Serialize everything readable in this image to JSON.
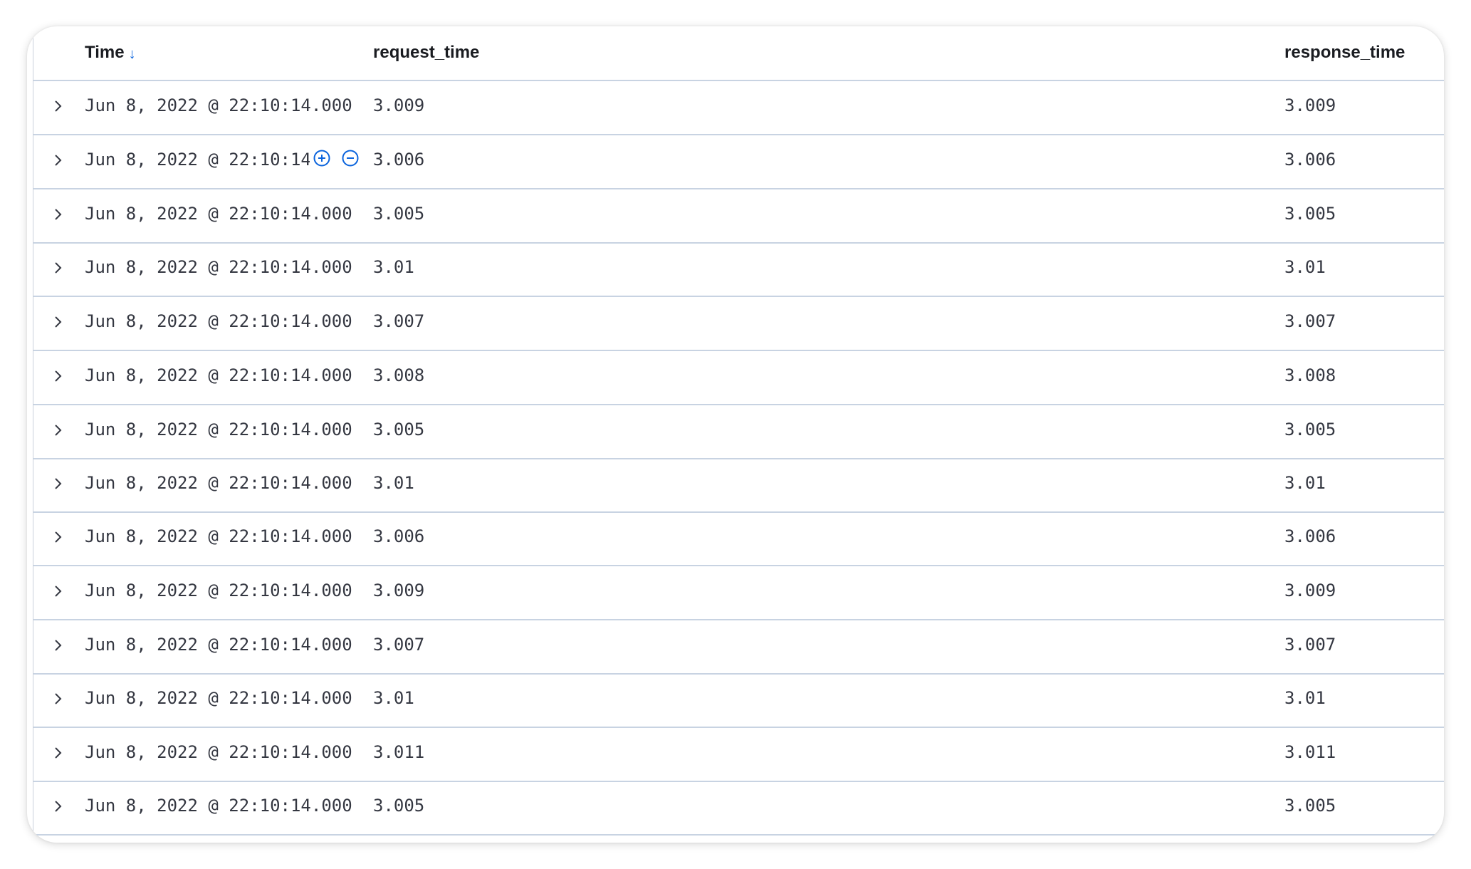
{
  "columns": {
    "time": "Time",
    "request_time": "request_time",
    "response_time": "response_time"
  },
  "icons": {
    "sort": "arrow-down-icon",
    "expand": "chevron-right-icon",
    "filter_for": "plus-circle-icon",
    "filter_out": "minus-circle-icon"
  },
  "colors": {
    "accent": "#0b64dd",
    "border": "#c8d3e2",
    "text": "#343741"
  },
  "rows": [
    {
      "time": "Jun 8, 2022 @ 22:10:14.000",
      "request_time": "3.009",
      "response_time": "3.009"
    },
    {
      "time": "Jun 8, 2022 @ 22:10:14.000",
      "request_time": "3.006",
      "response_time": "3.006"
    },
    {
      "time": "Jun 8, 2022 @ 22:10:14.000",
      "request_time": "3.005",
      "response_time": "3.005"
    },
    {
      "time": "Jun 8, 2022 @ 22:10:14.000",
      "request_time": "3.01",
      "response_time": "3.01"
    },
    {
      "time": "Jun 8, 2022 @ 22:10:14.000",
      "request_time": "3.007",
      "response_time": "3.007"
    },
    {
      "time": "Jun 8, 2022 @ 22:10:14.000",
      "request_time": "3.008",
      "response_time": "3.008"
    },
    {
      "time": "Jun 8, 2022 @ 22:10:14.000",
      "request_time": "3.005",
      "response_time": "3.005"
    },
    {
      "time": "Jun 8, 2022 @ 22:10:14.000",
      "request_time": "3.01",
      "response_time": "3.01"
    },
    {
      "time": "Jun 8, 2022 @ 22:10:14.000",
      "request_time": "3.006",
      "response_time": "3.006"
    },
    {
      "time": "Jun 8, 2022 @ 22:10:14.000",
      "request_time": "3.009",
      "response_time": "3.009"
    },
    {
      "time": "Jun 8, 2022 @ 22:10:14.000",
      "request_time": "3.007",
      "response_time": "3.007"
    },
    {
      "time": "Jun 8, 2022 @ 22:10:14.000",
      "request_time": "3.01",
      "response_time": "3.01"
    },
    {
      "time": "Jun 8, 2022 @ 22:10:14.000",
      "request_time": "3.011",
      "response_time": "3.011"
    },
    {
      "time": "Jun 8, 2022 @ 22:10:14.000",
      "request_time": "3.005",
      "response_time": "3.005"
    }
  ]
}
